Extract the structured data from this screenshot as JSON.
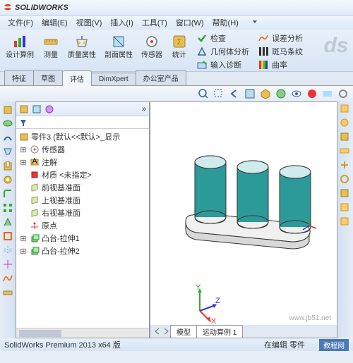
{
  "app": {
    "name": "SOLIDWORKS"
  },
  "menubar": {
    "file": "文件(F)",
    "edit": "编辑(E)",
    "view": "视图(V)",
    "insert": "插入(I)",
    "tools": "工具(T)",
    "window": "窗口(W)",
    "help": "帮助(H)"
  },
  "ribbon": {
    "design_study": "设计算例",
    "measure": "测量",
    "mass_props": "质量属性",
    "section_props": "剖面属性",
    "sensor": "传感器",
    "stats": "统计",
    "check": "检查",
    "geom_analysis": "几何体分析",
    "input_diag": "输入诊断",
    "dev_analysis": "误差分析",
    "zebra": "斑马条纹",
    "curvature": "曲率"
  },
  "tabs": {
    "feature": "特征",
    "sketch": "草图",
    "evaluate": "评估",
    "dimxpert": "DimXpert",
    "office": "办公室产品"
  },
  "tree": {
    "root": "零件3 (默认<<默认>_显示",
    "sensors": "传感器",
    "annotations": "注解",
    "material": "材质 <未指定>",
    "front_plane": "前视基准面",
    "top_plane": "上视基准面",
    "right_plane": "右视基准面",
    "origin": "原点",
    "extrude1": "凸台-拉伸1",
    "extrude2": "凸台-拉伸2"
  },
  "bottom_tabs": {
    "model": "模型",
    "motion": "运动算例 1"
  },
  "status": {
    "version": "SolidWorks Premium 2013 x64 版",
    "mode": "在编辑 零件"
  },
  "watermark": "www.jb51.net",
  "wm2": "教程网"
}
